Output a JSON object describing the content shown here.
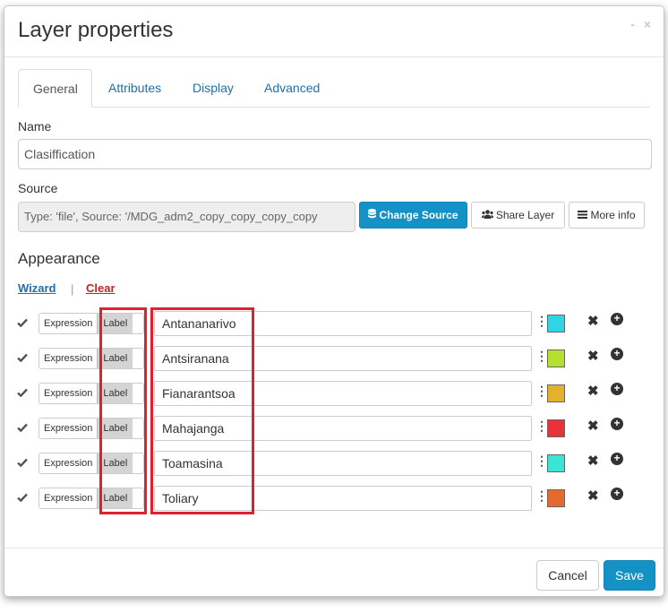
{
  "dialog": {
    "title": "Layer properties",
    "minimize_glyph": "-",
    "close_glyph": "×"
  },
  "tabs": [
    {
      "label": "General",
      "active": true
    },
    {
      "label": "Attributes",
      "active": false
    },
    {
      "label": "Display",
      "active": false
    },
    {
      "label": "Advanced",
      "active": false
    }
  ],
  "general": {
    "name_label": "Name",
    "name_value": "Clasiffication",
    "source_label": "Source",
    "source_value": "Type: 'file', Source: '/MDG_adm2_copy_copy_copy_copy",
    "change_source_label": "Change Source",
    "share_layer_label": "Share Layer",
    "more_info_label": "More info"
  },
  "appearance": {
    "title": "Appearance",
    "wizard_label": "Wizard",
    "separator": "|",
    "clear_label": "Clear",
    "expression_label": "Expression",
    "label_label": "Label",
    "rules": [
      {
        "value": "Antananarivo",
        "color": "#31d3e4"
      },
      {
        "value": "Antsiranana",
        "color": "#b5e02f"
      },
      {
        "value": "Fianarantsoa",
        "color": "#e3b12b"
      },
      {
        "value": "Mahajanga",
        "color": "#e8323a"
      },
      {
        "value": "Toamasina",
        "color": "#3de3d3"
      },
      {
        "value": "Toliary",
        "color": "#e46a2f"
      }
    ]
  },
  "footer": {
    "cancel_label": "Cancel",
    "save_label": "Save"
  },
  "colors": {
    "primary": "#1592c5",
    "link": "#1f6fa8",
    "danger": "#cc1f1f",
    "highlight": "#e0202f"
  },
  "icons": {
    "check": "check-icon",
    "remove": "times-icon",
    "add": "plus-circle-icon",
    "database": "database-icon",
    "users": "users-icon",
    "list": "list-icon",
    "more": "vertical-ellipsis-icon"
  }
}
